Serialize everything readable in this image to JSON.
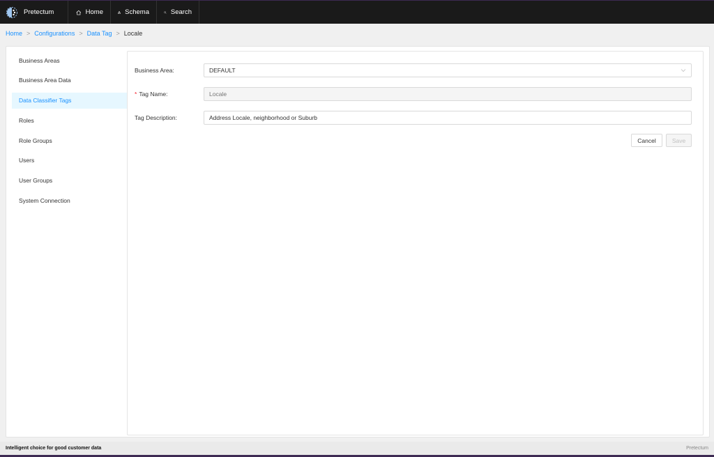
{
  "topbar": {
    "brand": "Pretectum",
    "nav": [
      {
        "label": "Home",
        "icon": "home-icon"
      },
      {
        "label": "Schema",
        "icon": "schema-icon"
      },
      {
        "label": "Search",
        "icon": "search-icon"
      }
    ]
  },
  "breadcrumb": {
    "items": [
      "Home",
      "Configurations",
      "Data Tag"
    ],
    "current": "Locale",
    "separator": ">"
  },
  "sidebar": {
    "items": [
      {
        "label": "Business Areas"
      },
      {
        "label": "Business Area Data"
      },
      {
        "label": "Data Classifier Tags",
        "active": true
      },
      {
        "label": "Roles"
      },
      {
        "label": "Role Groups"
      },
      {
        "label": "Users"
      },
      {
        "label": "User Groups"
      },
      {
        "label": "System Connection"
      }
    ]
  },
  "form": {
    "business_area": {
      "label": "Business Area",
      "value": "DEFAULT"
    },
    "tag_name": {
      "label": "Tag Name",
      "placeholder": "Locale",
      "required_mark": "*"
    },
    "tag_description": {
      "label": "Tag Description",
      "value": "Address Locale, neighborhood or Suburb"
    },
    "colon": ":"
  },
  "actions": {
    "cancel": "Cancel",
    "save": "Save"
  },
  "footer": {
    "tagline": "Intelligent choice for good customer data",
    "copyright": "Pretectum"
  },
  "colors": {
    "accent": "#1890ff",
    "topbar": "#1a1a1a",
    "active_bg": "#e6f7ff",
    "required": "#f5222d"
  }
}
